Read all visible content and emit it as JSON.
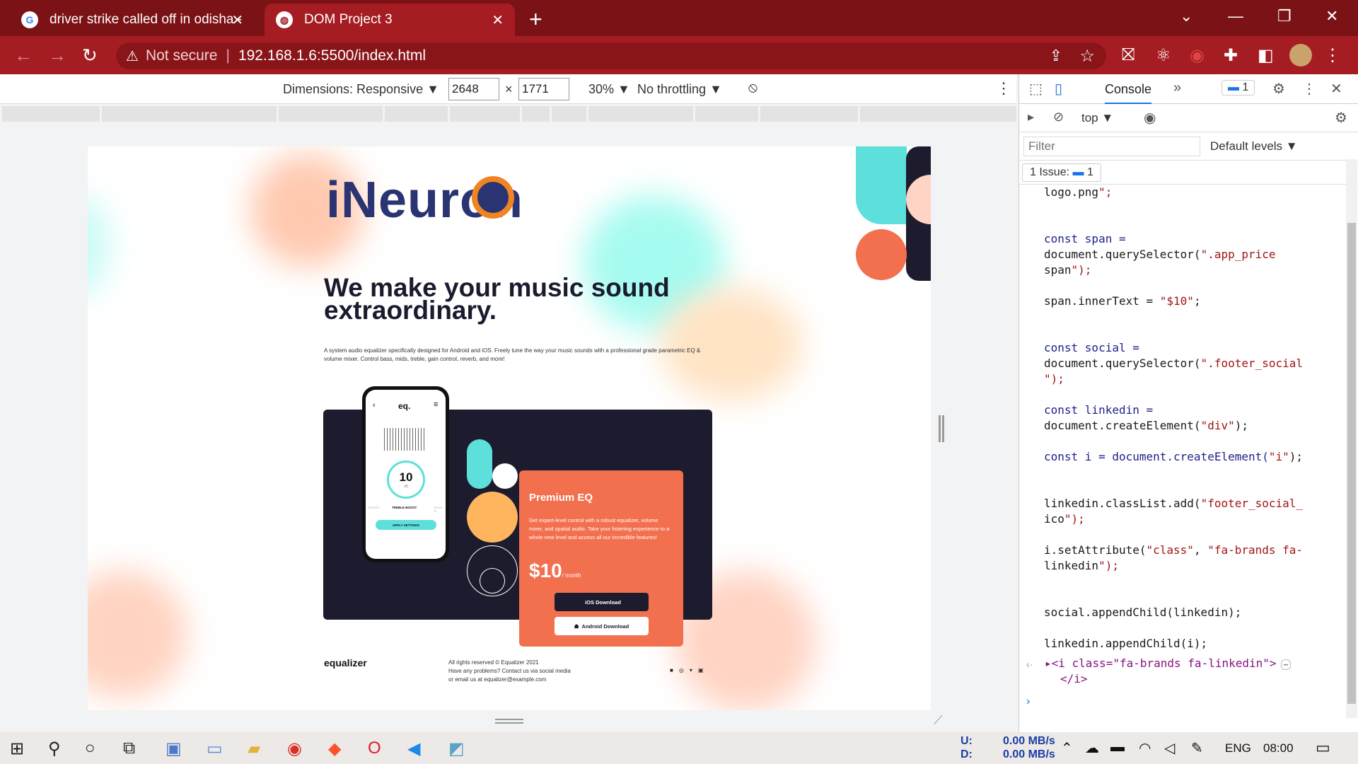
{
  "tabs": [
    {
      "title": "driver strike called off in odisha -",
      "icon": "google-icon"
    },
    {
      "title": "DOM Project 3",
      "icon": "globe-icon",
      "active": true
    }
  ],
  "address": {
    "security": "Not secure",
    "url": "192.168.1.6:5500/index.html"
  },
  "device_toolbar": {
    "dimensions": "Dimensions: Responsive",
    "width": "2648",
    "height": "1771",
    "times": "×",
    "zoom": "30%",
    "throttling": "No throttling"
  },
  "page": {
    "logo_text": "iNeuron",
    "headline": "We make your music sound extraordinary.",
    "description": "A system audio equalizer specifically designed for Android and iOS. Freely tune the way your music sounds with a professional grade parametric EQ & volume mixer. Control bass, mids, treble, gain control, reverb, and more!",
    "phone": {
      "app_name": "eq.",
      "value": "10",
      "unit": "dB",
      "labels": [
        "BOOST",
        "TREBLE BOOST",
        "BASS B"
      ],
      "button": "APPLY SETTINGS"
    },
    "card": {
      "title": "Premium EQ",
      "description": "Get expert-level control with a robust equalizer, volume mixer, and spatial audio. Take your listening experience to a whole new level and access all our incredible features!",
      "price": "$10",
      "period": "/ month",
      "ios_button": "iOS Download",
      "android_button": "Android Download"
    },
    "footer": {
      "brand": "equalizer",
      "line1": "All rights reserved © Equalizer 2021",
      "line2": "Have any problems? Contact us via social media",
      "line3": "or email us at equalizer@example.com"
    }
  },
  "devtools": {
    "tab": "Console",
    "issues_badge": "1",
    "context": "top",
    "filter_placeholder": "Filter",
    "levels": "Default levels",
    "issue_text": "1 Issue:",
    "issue_count": "1"
  },
  "console_lines": [
    "logo.png\";",
    "",
    "",
    "const span =",
    "document.querySelector(\".app_price",
    "span\");",
    "",
    "span.innerText = \"$10\";",
    "",
    "",
    "const social =",
    "document.querySelector(\".footer_social",
    "\");",
    "",
    "const linkedin =",
    "document.createElement(\"div\");",
    "",
    "const i = document.createElement(\"i\");",
    "",
    "",
    "linkedin.classList.add(\"footer_social_",
    "ico\");",
    "",
    "i.setAttribute(\"class\", \"fa-brands fa-",
    "linkedin\");",
    "",
    "",
    "social.appendChild(linkedin);",
    "",
    "linkedin.appendChild(i);"
  ],
  "console_result": "<i class=\"fa-brands fa-linkedin\">",
  "console_result_close": "</i>",
  "taskbar": {
    "net_up_label": "U:",
    "net_down_label": "D:",
    "net_up": "0.00 MB/s",
    "net_down": "0.00 MB/s",
    "lang": "ENG",
    "time": "08:00"
  }
}
